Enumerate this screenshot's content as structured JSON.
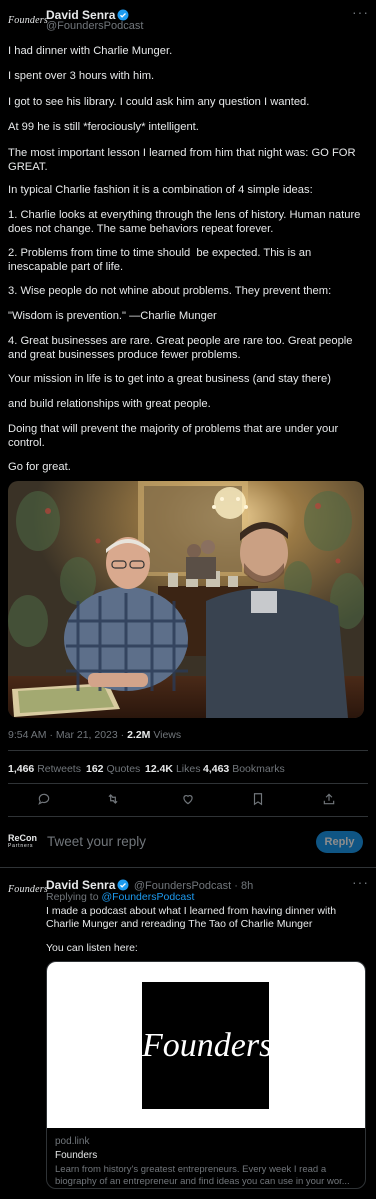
{
  "tweet": {
    "avatar_text": "Founders",
    "author": "David Senra",
    "handle": "@FoundersPodcast",
    "more": "···",
    "paragraphs": [
      "I had dinner with Charlie Munger.",
      "I spent over 3 hours with him.",
      "I got to see his library. I could ask him any question I wanted.",
      "At 99 he is still *ferociously* intelligent.",
      "The most important lesson I learned from him that night was: GO FOR GREAT.",
      "In typical Charlie fashion it is a combination of 4 simple ideas:",
      "1. Charlie looks at everything through the lens of history. Human nature does not change. The same behaviors repeat forever.",
      "2. Problems from time to time should  be expected. This is an inescapable part of life.",
      "3. Wise people do not whine about problems. They prevent them:",
      "\"Wisdom is prevention.\" —Charlie Munger",
      "4. Great businesses are rare. Great people are rare too. Great people and great businesses produce fewer problems.",
      "Your mission in life is to get into a great business (and stay there)",
      "and build relationships with great people.",
      "Doing that will prevent the majority of problems that are under your control.",
      "Go for great."
    ],
    "timestamp": "9:54 AM · Mar 21, 2023 · ",
    "views_count": "2.2M",
    "views_label": " Views",
    "stats": {
      "retweets": "1,466",
      "retweets_label": "Retweets",
      "quotes": "162",
      "quotes_label": "Quotes",
      "likes": "12.4K",
      "likes_label": "Likes",
      "bookmarks": "4,463",
      "bookmarks_label": "Bookmarks"
    }
  },
  "compose": {
    "avatar_text": "ReCon",
    "avatar_sub": "Partners",
    "placeholder": "Tweet your reply",
    "reply_label": "Reply"
  },
  "reply": {
    "avatar_text": "Founders",
    "author": "David Senra",
    "handle": "@FoundersPodcast",
    "time": " · 8h",
    "more": "···",
    "replying_to_label": "Replying to ",
    "replying_to_handle": "@FoundersPodcast",
    "text": "I made a podcast about what I learned from having dinner with Charlie Munger and rereading The Tao of Charlie Munger",
    "listen": "You can listen here:",
    "card": {
      "logo_text": "Founders",
      "domain": "pod.link",
      "title": "Founders",
      "description": "Learn from history's greatest entrepreneurs. Every week I read a biography of an entrepreneur and find ideas you can use in your wor..."
    }
  },
  "colors": {
    "background": "#000000",
    "text": "#e7e9ea",
    "secondary": "#71767b",
    "accent": "#1d9bf0",
    "divider": "#2f3336"
  }
}
